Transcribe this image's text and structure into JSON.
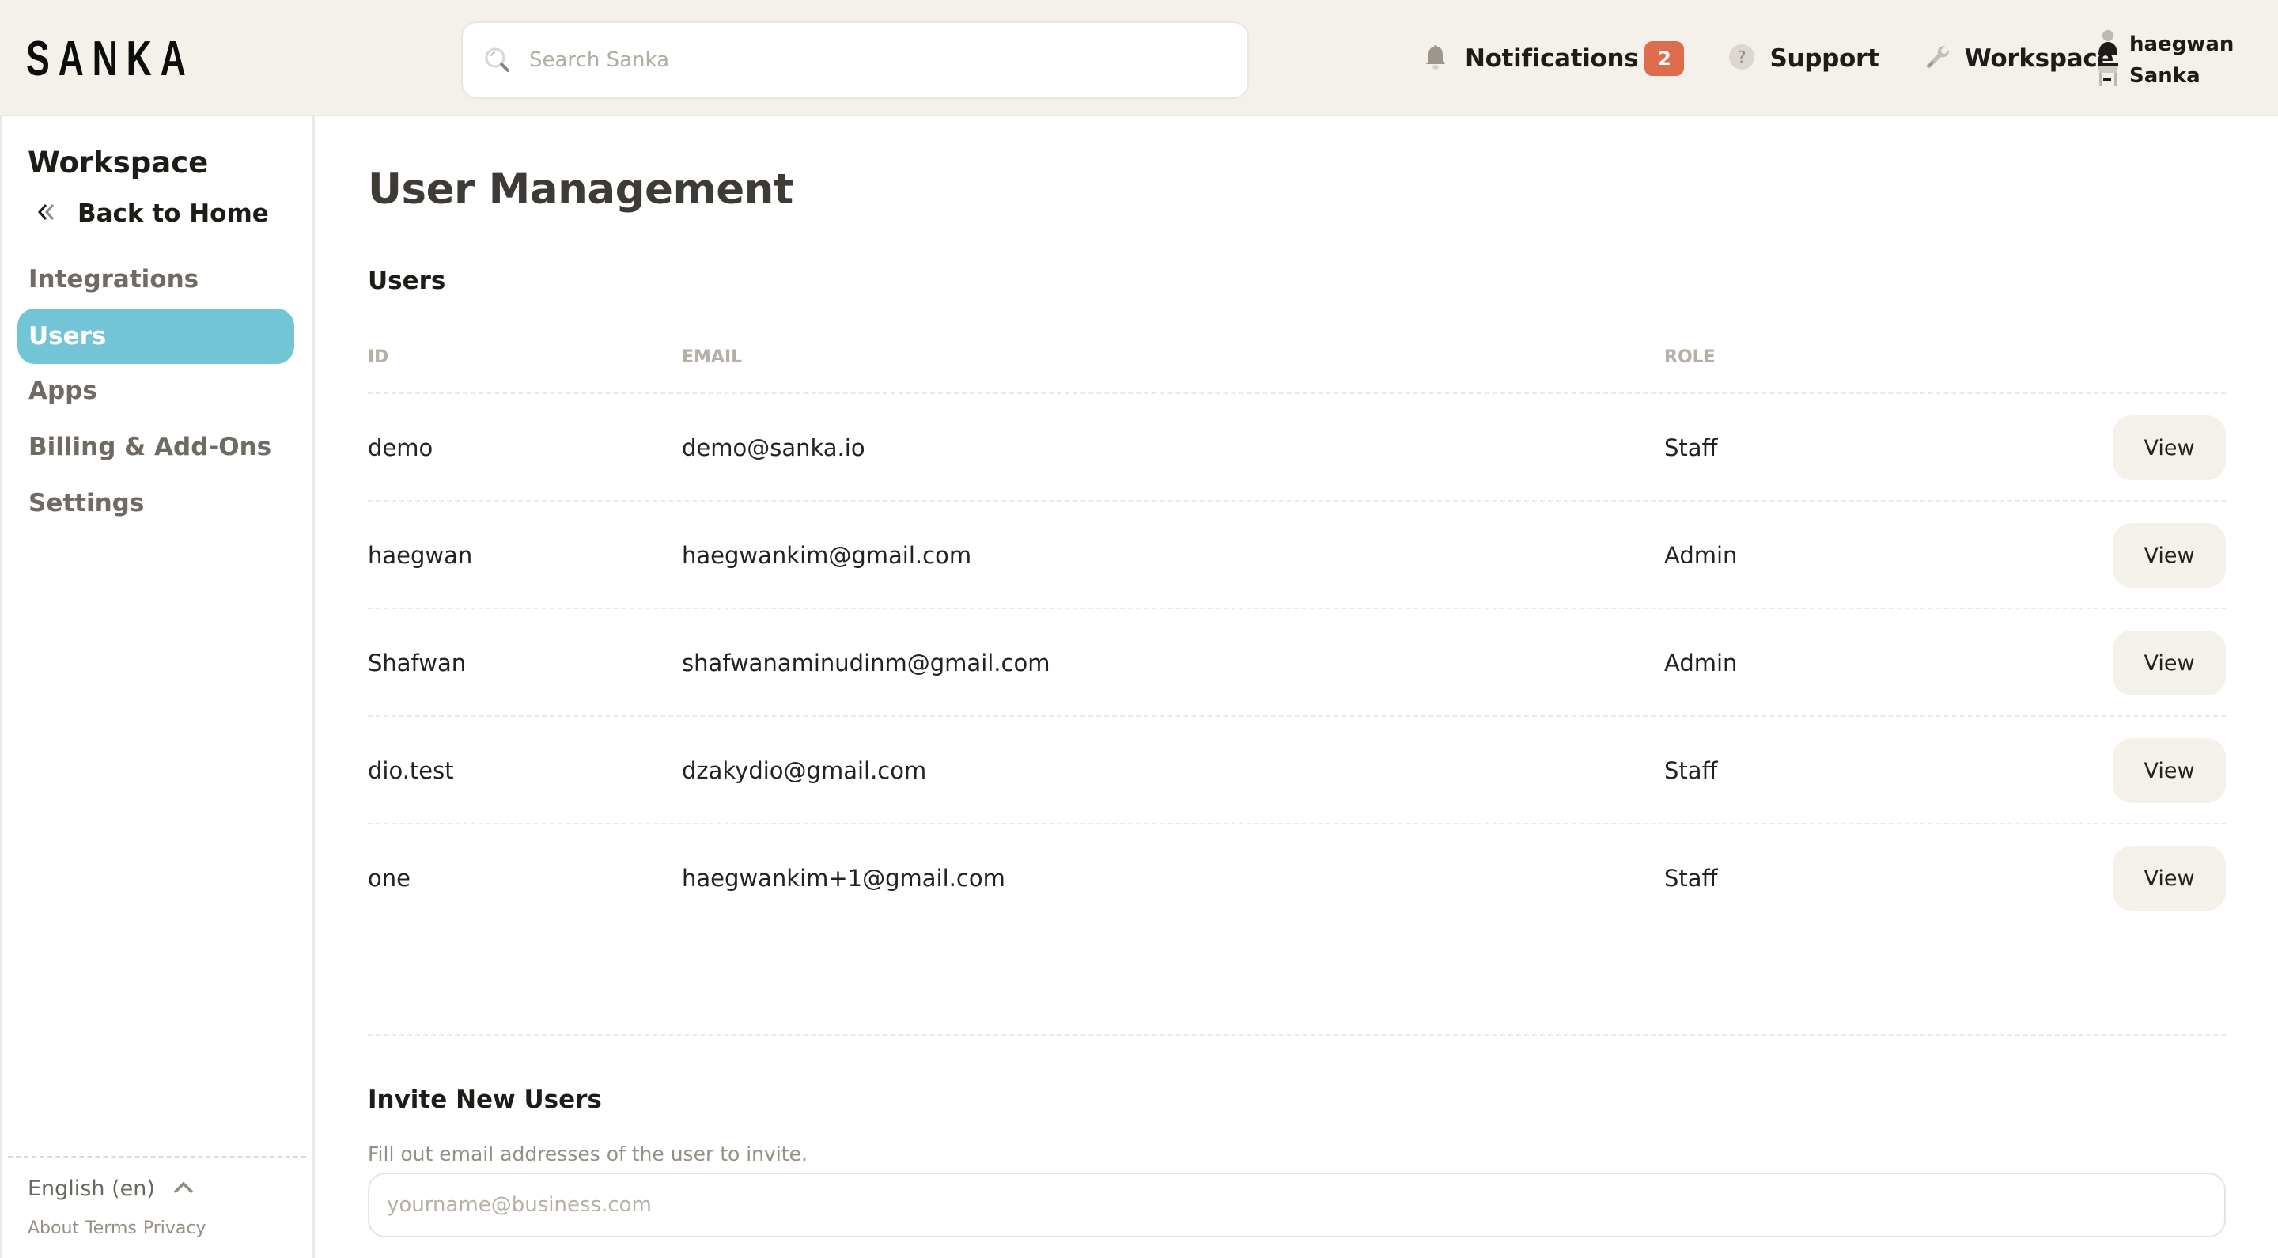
{
  "header": {
    "logo": "SANKA",
    "search": {
      "placeholder": "Search Sanka",
      "value": "",
      "icon": "search-icon"
    },
    "nav": {
      "notifications": {
        "label": "Notifications",
        "count": "2",
        "icon": "bell-icon"
      },
      "support": {
        "label": "Support",
        "icon": "question-circle-icon"
      },
      "workspace": {
        "label": "Workspace",
        "icon": "wrench-icon"
      }
    },
    "user": {
      "name": "haegwan",
      "workspace": "Sanka",
      "user_icon": "user-icon",
      "workspace_icon": "store-icon"
    }
  },
  "colors": {
    "header_bg": "#f4f0ea",
    "accent": "#72c4d7",
    "badge": "#e06c50",
    "button_bg": "#f4f0ea"
  },
  "sidebar": {
    "title": "Workspace",
    "back": {
      "label": "Back to Home",
      "icon": "chevrons-left-icon"
    },
    "items": [
      {
        "label": "Integrations",
        "active": false
      },
      {
        "label": "Users",
        "active": true
      },
      {
        "label": "Apps",
        "active": false
      },
      {
        "label": "Billing & Add-Ons",
        "active": false
      },
      {
        "label": "Settings",
        "active": false
      }
    ],
    "language": {
      "label": "English (en)",
      "icon": "chevron-up-icon"
    },
    "footer_links": [
      "About",
      "Terms",
      "Privacy"
    ]
  },
  "main": {
    "title": "User Management",
    "users_section": {
      "title": "Users",
      "columns": [
        "ID",
        "EMAIL",
        "ROLE"
      ],
      "rows": [
        {
          "id": "demo",
          "email": "demo@sanka.io",
          "role": "Staff",
          "action": "View"
        },
        {
          "id": "haegwan",
          "email": "haegwankim@gmail.com",
          "role": "Admin",
          "action": "View"
        },
        {
          "id": "Shafwan",
          "email": "shafwanaminudinm@gmail.com",
          "role": "Admin",
          "action": "View"
        },
        {
          "id": "dio.test",
          "email": "dzakydio@gmail.com",
          "role": "Staff",
          "action": "View"
        },
        {
          "id": "one",
          "email": "haegwankim+1@gmail.com",
          "role": "Staff",
          "action": "View"
        }
      ]
    },
    "invite_section": {
      "title": "Invite New Users",
      "helper": "Fill out email addresses of the user to invite.",
      "input_placeholder": "yourname@business.com",
      "input_value": ""
    }
  }
}
